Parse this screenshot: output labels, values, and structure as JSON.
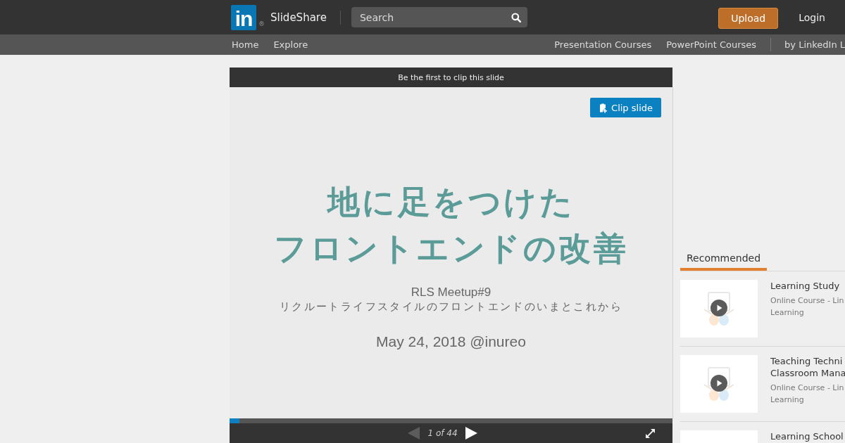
{
  "header": {
    "logo": {
      "mark": "in",
      "registered": "®",
      "name": "SlideShare"
    },
    "search": {
      "placeholder": "Search"
    },
    "upload_button": "Upload",
    "login_link": "Login"
  },
  "nav": {
    "left": [
      "Home",
      "Explore"
    ],
    "right": [
      "Presentation Courses",
      "PowerPoint Courses"
    ],
    "partner": "by LinkedIn L"
  },
  "player": {
    "clip_bar": "Be the first to clip this slide",
    "clip_button": "Clip slide",
    "slide": {
      "title_lines": [
        "地に足をつけた",
        "フロントエンドの改善"
      ],
      "event": "RLS Meetup#9",
      "subtitle": "リクルートライフスタイルのフロントエンドのいまとこれから",
      "date": "May 24, 2018 @inureo"
    },
    "progress": {
      "level": 0.023
    },
    "controls": {
      "previous": {
        "disabled": true
      },
      "next": {
        "disabled": false
      },
      "page": "1 of 44"
    }
  },
  "sidebar": {
    "tabs": [
      {
        "label": "Recommended",
        "selected": true
      }
    ],
    "items": [
      {
        "title_lines": [
          "Learning Study"
        ],
        "meta_lines": [
          "Online Course - Lin",
          "Learning"
        ],
        "has_preview": true
      },
      {
        "title_lines": [
          "Teaching Techni",
          "Classroom Mana"
        ],
        "meta_lines": [
          "Online Course - Lin",
          "Learning"
        ],
        "has_preview": true
      },
      {
        "title_lines": [
          "Learning School"
        ],
        "has_preview": false
      }
    ]
  }
}
